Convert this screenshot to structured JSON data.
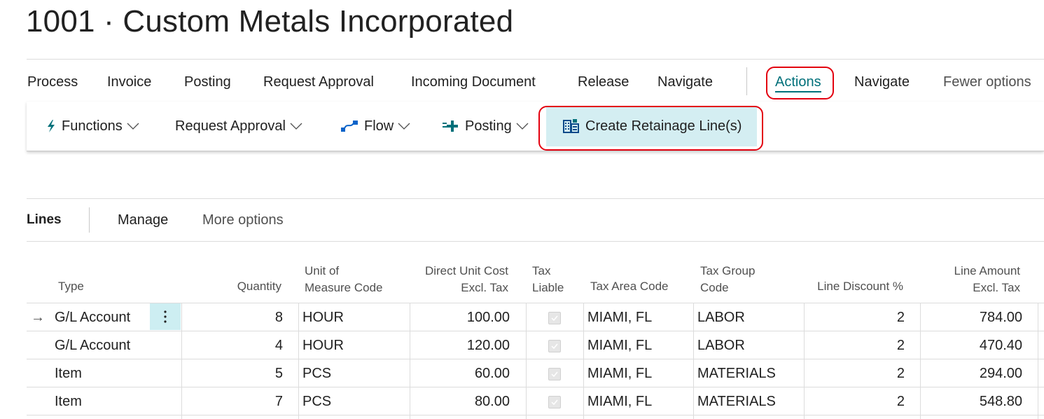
{
  "page": {
    "title": "1001 · Custom Metals Incorporated"
  },
  "action_bar": {
    "items": [
      "Process",
      "Invoice",
      "Posting",
      "Request Approval",
      "Incoming Document",
      "Release",
      "Navigate"
    ],
    "actions_label": "Actions",
    "navigate_label": "Navigate",
    "fewer_options_label": "Fewer options"
  },
  "ribbon": {
    "functions": "Functions",
    "request_approval": "Request Approval",
    "flow": "Flow",
    "posting": "Posting",
    "create_retainage": "Create Retainage Line(s)"
  },
  "lines_part": {
    "title": "Lines",
    "manage": "Manage",
    "more_options": "More options"
  },
  "table": {
    "headers": {
      "type": "Type",
      "quantity": "Quantity",
      "uom": [
        "Unit of",
        "Measure Code"
      ],
      "cost": [
        "Direct Unit Cost",
        "Excl. Tax"
      ],
      "liable": [
        "Tax",
        "Liable"
      ],
      "area": "Tax Area Code",
      "group": [
        "Tax Group",
        "Code"
      ],
      "disc": "Line Discount %",
      "amount": [
        "Line Amount",
        "Excl. Tax"
      ]
    },
    "rows": [
      {
        "type": "G/L Account",
        "quantity": "8",
        "uom": "HOUR",
        "cost": "100.00",
        "liable": true,
        "area": "MIAMI, FL",
        "group": "LABOR",
        "disc": "2",
        "amount": "784.00"
      },
      {
        "type": "G/L Account",
        "quantity": "4",
        "uom": "HOUR",
        "cost": "120.00",
        "liable": true,
        "area": "MIAMI, FL",
        "group": "LABOR",
        "disc": "2",
        "amount": "470.40"
      },
      {
        "type": "Item",
        "quantity": "5",
        "uom": "PCS",
        "cost": "60.00",
        "liable": true,
        "area": "MIAMI, FL",
        "group": "MATERIALS",
        "disc": "2",
        "amount": "294.00"
      },
      {
        "type": "Item",
        "quantity": "7",
        "uom": "PCS",
        "cost": "80.00",
        "liable": true,
        "area": "MIAMI, FL",
        "group": "MATERIALS",
        "disc": "2",
        "amount": "548.80"
      }
    ],
    "current_row_marker": "→"
  },
  "colors": {
    "accent": "#00707a",
    "highlight_bg": "#d4eef2",
    "annotation_red": "#e3000f"
  }
}
